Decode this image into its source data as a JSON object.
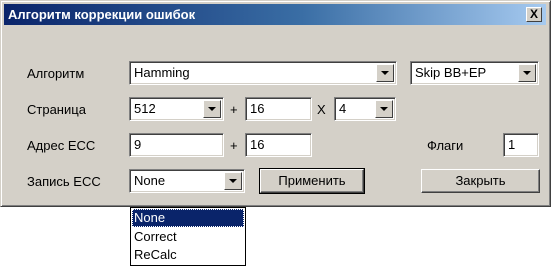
{
  "window": {
    "title": "Алгоритм коррекции ошибок",
    "close_glyph": "X"
  },
  "algorithm": {
    "label": "Алгоритм",
    "value": "Hamming",
    "skip_value": "Skip BB+EP"
  },
  "page": {
    "label": "Страница",
    "size_value": "512",
    "plus": "+",
    "offset_value": "16",
    "times": "X",
    "count_value": "4"
  },
  "ecc_address": {
    "label": "Адрес ECC",
    "value": "9",
    "plus": "+",
    "offset_value": "16"
  },
  "flags": {
    "label": "Флаги",
    "value": "1"
  },
  "ecc_write": {
    "label": "Запись ECC",
    "value": "None",
    "options": [
      "None",
      "Correct",
      "ReCalc"
    ]
  },
  "buttons": {
    "apply": "Применить",
    "close": "Закрыть"
  }
}
